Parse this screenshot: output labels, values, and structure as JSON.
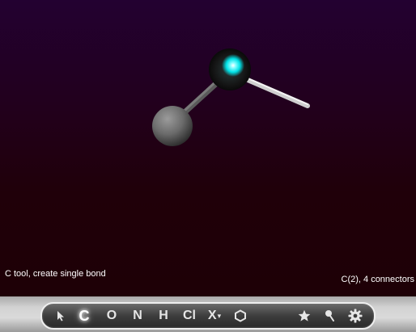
{
  "viewer": {
    "status_text": "C tool, create single bond",
    "selection_info": "C(2), 4 connectors",
    "atoms": [
      {
        "name": "carbon-atom",
        "element": "C",
        "color": "#8a8a8a"
      },
      {
        "name": "selected-carbon-atom",
        "element": "C",
        "color": "#00e5e5"
      }
    ],
    "bond_color": "#d8d8d8"
  },
  "toolbar": {
    "select_icon": "arrow-cursor-icon",
    "carbon_label": "C",
    "oxygen_label": "O",
    "nitrogen_label": "N",
    "hydrogen_label": "H",
    "chlorine_label": "Cl",
    "other_label": "X",
    "other_caret": "▾",
    "ring_icon": "hexagon-icon",
    "favorite_icon": "star-icon",
    "probe_icon": "pin-icon",
    "settings_icon": "gear-icon",
    "active_tool": "carbon"
  }
}
